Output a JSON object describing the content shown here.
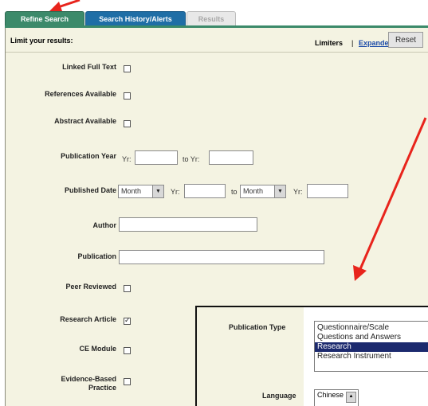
{
  "tabs": {
    "refine": "Refine Search",
    "history": "Search History/Alerts",
    "results": "Results"
  },
  "limit_bar": {
    "title": "Limit your results:",
    "limiters": "Limiters",
    "separator": "|",
    "expanders": "Expanders",
    "reset": "Reset"
  },
  "fields": {
    "linked_full_text": "Linked Full Text",
    "references_available": "References Available",
    "abstract_available": "Abstract Available",
    "publication_year": "Publication Year",
    "published_date": "Published Date",
    "author": "Author",
    "publication": "Publication",
    "peer_reviewed": "Peer Reviewed",
    "research_article": "Research Article",
    "ce_module": "CE Module",
    "evidence_based_1": "Evidence-Based",
    "evidence_based_2": "Practice"
  },
  "inputs": {
    "yr_label": "Yr:",
    "to_yr_label": "to Yr:",
    "to_label": "to",
    "month": "Month",
    "research_article_checked": true
  },
  "inset": {
    "publication_type_label": "Publication Type",
    "options": [
      "Questionnaire/Scale",
      "Questions and Answers",
      "Research",
      "Research Instrument"
    ],
    "selected": "Research",
    "language_label": "Language",
    "language_value": "Chinese"
  },
  "colors": {
    "refine_tab": "#3c8a6a",
    "history_tab": "#1f6ea6",
    "panel_bg": "#f4f3e2",
    "arrow": "#e8241c",
    "selected_option": "#1c2a6e"
  }
}
